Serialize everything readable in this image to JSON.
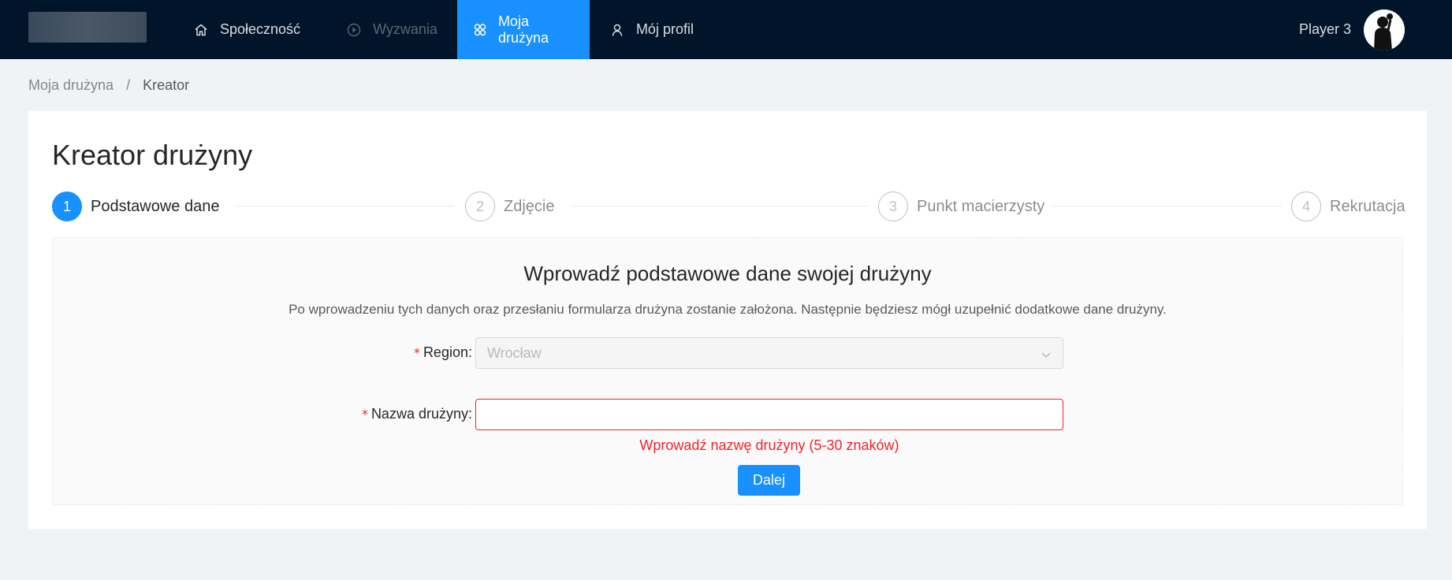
{
  "nav": {
    "items": [
      {
        "label": "Społeczność",
        "icon": "home-icon"
      },
      {
        "label": "Wyzwania",
        "icon": "play-circle-icon"
      },
      {
        "label": "Moja drużyna",
        "icon": "team-icon"
      },
      {
        "label": "Mój profil",
        "icon": "user-icon"
      }
    ],
    "user_name": "Player 3"
  },
  "breadcrumb": [
    "Moja drużyna",
    "Kreator"
  ],
  "page": {
    "title": "Kreator drużyny"
  },
  "steps": [
    {
      "number": "1",
      "label": "Podstawowe dane",
      "state": "active"
    },
    {
      "number": "2",
      "label": "Zdjęcie",
      "state": "waiting"
    },
    {
      "number": "3",
      "label": "Punkt macierzysty",
      "state": "waiting"
    },
    {
      "number": "4",
      "label": "Rekrutacja",
      "state": "waiting"
    }
  ],
  "form": {
    "heading": "Wprowadź podstawowe dane swojej drużyny",
    "description": "Po wprowadzeniu tych danych oraz przesłaniu formularza drużyna zostanie założona. Następnie będziesz mógł uzupełnić dodatkowe dane drużyny.",
    "region": {
      "label": "Region",
      "value": "Wrocław"
    },
    "team_name": {
      "label": "Nazwa drużyny",
      "value": "",
      "error": "Wprowadź nazwę drużyny (5-30 znaków)"
    },
    "submit_label": "Dalej",
    "required_mark": "*",
    "label_suffix": ":"
  },
  "colors": {
    "header_bg": "#001529",
    "primary": "#1890ff",
    "error": "#f5222d",
    "page_bg": "#f0f2f5"
  }
}
